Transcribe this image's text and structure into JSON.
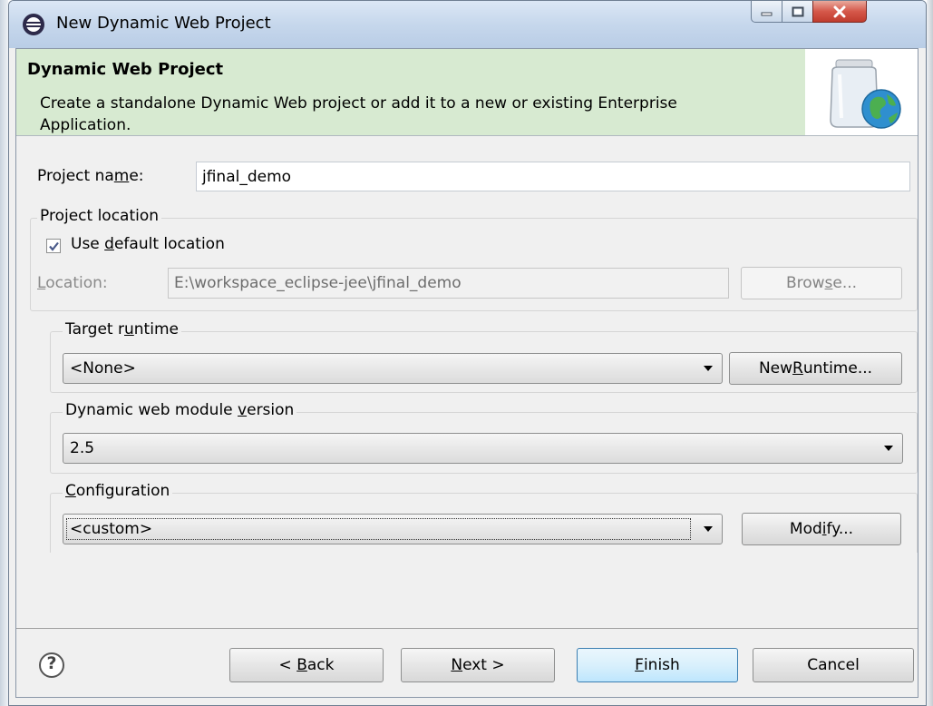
{
  "window": {
    "title": "New Dynamic Web Project",
    "controls": {
      "minimize": "–",
      "maximize": "□",
      "close": "✕"
    }
  },
  "banner": {
    "title": "Dynamic Web Project",
    "description": "Create a standalone Dynamic Web project or add it to a new or existing Enterprise Application.",
    "icon": "jar-globe-icon"
  },
  "project_name": {
    "label_before": "Project na",
    "label_mnemonic": "m",
    "label_after": "e:",
    "value": "jfinal_demo"
  },
  "project_location": {
    "group_title": "Project location",
    "use_default": {
      "label_before": "Use ",
      "label_mnemonic": "d",
      "label_after": "efault location",
      "checked": true
    },
    "location_label_mnemonic": "L",
    "location_label_after": "ocation:",
    "location_value": "E:\\workspace_eclipse-jee\\jfinal_demo",
    "browse_before": "Brow",
    "browse_mnemonic": "s",
    "browse_after": "e..."
  },
  "target_runtime": {
    "title_before": "Target r",
    "title_mnemonic": "u",
    "title_after": "ntime",
    "selected": "<None>",
    "new_runtime_before": "New ",
    "new_runtime_mnemonic": "R",
    "new_runtime_after": "untime..."
  },
  "module_version": {
    "title_before": "Dynamic web module ",
    "title_mnemonic": "v",
    "title_after": "ersion",
    "selected": "2.5"
  },
  "configuration": {
    "title_mnemonic": "C",
    "title_after": "onfiguration",
    "selected": "<custom>",
    "modify_before": "Mod",
    "modify_mnemonic": "i",
    "modify_after": "fy..."
  },
  "footer": {
    "help_glyph": "?",
    "back_before": "< ",
    "back_mnemonic": "B",
    "back_after": "ack",
    "next_mnemonic": "N",
    "next_after": "ext >",
    "finish_mnemonic": "F",
    "finish_after": "inish",
    "cancel": "Cancel"
  },
  "colors": {
    "banner_bg": "#d7ead1",
    "dialog_bg": "#f0f0f0",
    "default_button_border": "#3c7fb1",
    "close_button": "#c03b2d"
  }
}
